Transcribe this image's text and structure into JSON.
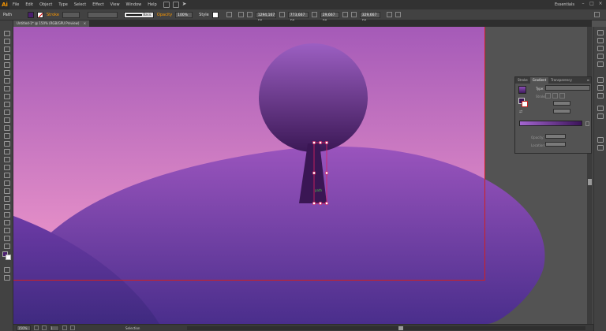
{
  "app": {
    "logo": "Ai",
    "workspace": "Essentials"
  },
  "menu": [
    "File",
    "Edit",
    "Object",
    "Type",
    "Select",
    "Effect",
    "View",
    "Window",
    "Help"
  ],
  "control": {
    "object_type": "Path",
    "stroke_label": "Stroke",
    "brush": "Basic",
    "opacity_label": "Opacity",
    "opacity_value": "100%",
    "style_label": "Style",
    "x_value": "1294,167 px",
    "y_value": "773,667 px",
    "w_value": "29,667 px",
    "h_value": "329,667 px",
    "fill_color": "#4a1f6e"
  },
  "document": {
    "tab_title": "Untitled-1* @ 150% (RGB/GPU Preview)",
    "close_glyph": "×"
  },
  "gradient_panel": {
    "tabs": [
      "Stroke",
      "Gradient",
      "Transparency"
    ],
    "type_label": "Type:",
    "stroke_label": "Stroke",
    "opacity_label": "Opacity:",
    "location_label": "Location:",
    "start_color": "#a466d0",
    "end_color": "#3b1359"
  },
  "status": {
    "zoom": "150%",
    "page": "1",
    "tool_name": "Selection"
  },
  "art": {
    "sky_top": "#a55ab8",
    "sky_bottom": "#f29acb",
    "hill_top": "#9a54bd",
    "hill_bottom": "#4a2e8c",
    "tree_top": "#9c5fc2",
    "tree_bottom": "#3b1856",
    "trunk": "#3a1654",
    "cursor_label": "path"
  }
}
